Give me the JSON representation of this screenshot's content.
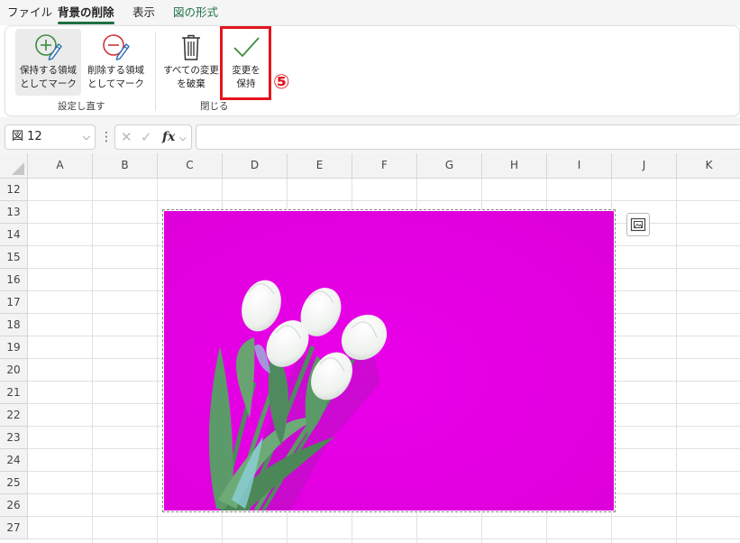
{
  "tabs": [
    {
      "label": "ファイル",
      "active": false
    },
    {
      "label": "背景の削除",
      "active": true
    },
    {
      "label": "表示",
      "active": false
    },
    {
      "label": "図の形式",
      "active": false,
      "contextual": true
    }
  ],
  "ribbon": {
    "buttons": {
      "mark_keep": {
        "label": "保持する領域\nとしてマーク",
        "icon": "pencil-plus-icon"
      },
      "mark_remove": {
        "label": "削除する領域\nとしてマーク",
        "icon": "pencil-minus-icon"
      },
      "discard": {
        "label": "すべての変更\nを破棄",
        "icon": "trash-icon"
      },
      "keep_changes": {
        "label": "変更を\n保持",
        "icon": "checkmark-icon"
      }
    },
    "groups": {
      "refine": "設定し直す",
      "close": "閉じる"
    },
    "annotation": "⑤"
  },
  "formula_bar": {
    "name_box": "図 12",
    "formula_value": ""
  },
  "columns": [
    "A",
    "B",
    "C",
    "D",
    "E",
    "F",
    "G",
    "H",
    "I",
    "J",
    "K"
  ],
  "rows": [
    "12",
    "13",
    "14",
    "15",
    "16",
    "17",
    "18",
    "19",
    "20",
    "21",
    "22",
    "23",
    "24",
    "25",
    "26",
    "27"
  ],
  "colors": {
    "accent_green": "#1e7145",
    "highlight_red": "#e3151d",
    "removal_magenta": "#e100e1"
  }
}
